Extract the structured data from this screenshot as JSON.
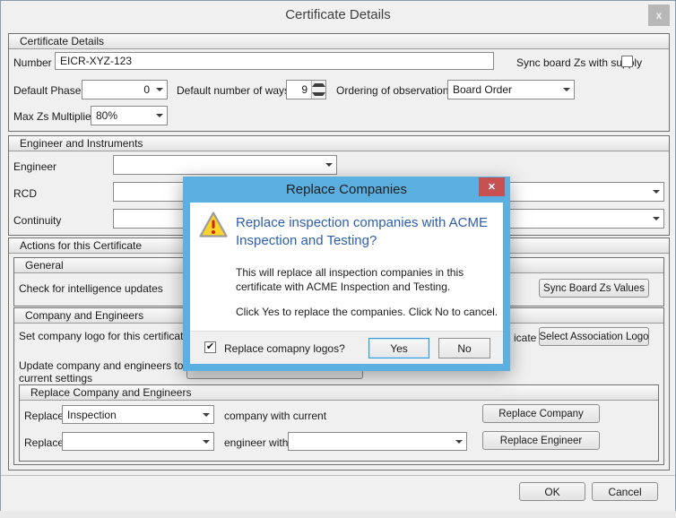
{
  "window": {
    "title": "Certificate Details"
  },
  "icons": {
    "window_close": "x",
    "modal_close": "✕",
    "check": "✔"
  },
  "colors": {
    "window_bg": "#f0f0f0",
    "modal_frame": "#5cb0e1",
    "modal_close_bg": "#c75050",
    "heading_blue": "#2e5eae",
    "focus_border": "#3399dd"
  },
  "cert": {
    "header": "Certificate Details",
    "number_label": "Number",
    "number_value": "EICR-XYZ-123",
    "sync_supply_label": "Sync board Zs with supply",
    "default_phase_label": "Default Phase",
    "default_phase_value": "0",
    "ways_label": "Default number of ways",
    "ways_value": "9",
    "ordering_label": "Ordering of observations",
    "ordering_value": "Board Order",
    "max_zs_label": "Max Zs Multiplier",
    "max_zs_value": "80%"
  },
  "engineer": {
    "header": "Engineer and Instruments",
    "engineer_label": "Engineer",
    "rcd_label": "RCD",
    "continuity_label": "Continuity"
  },
  "actions": {
    "header": "Actions for this Certificate",
    "general_header": "General",
    "intelligence_label": "Check for intelligence updates",
    "sync_board_button": "Sync Board Zs Values",
    "company_header": "Company and Engineers",
    "set_logo_label": "Set company logo for this certificate",
    "assoc_fragment": "icate",
    "select_assoc_button": "Select Association Logo",
    "update_label": "Update company and engineers to\ncurrent settings",
    "replace_header": "Replace Company and Engineers",
    "replace_label": "Replace",
    "company_combo_value": "Inspection",
    "company_with_label": "company with current",
    "replace_company_button": "Replace Company",
    "engineer_with_label": "engineer with",
    "replace_engineer_button": "Replace Engineer"
  },
  "footer": {
    "ok_button": "OK",
    "cancel_button": "Cancel"
  },
  "modal": {
    "title": "Replace Companies",
    "heading": "Replace inspection companies with ACME\nInspection and Testing?",
    "body_line1": "This will replace all inspection companies in this\ncertificate with ACME Inspection and Testing.",
    "body_line2": "Click Yes to replace the companies.  Click No to cancel.",
    "checkbox_label": "Replace comapny logos?",
    "yes_button": "Yes",
    "no_button": "No"
  }
}
